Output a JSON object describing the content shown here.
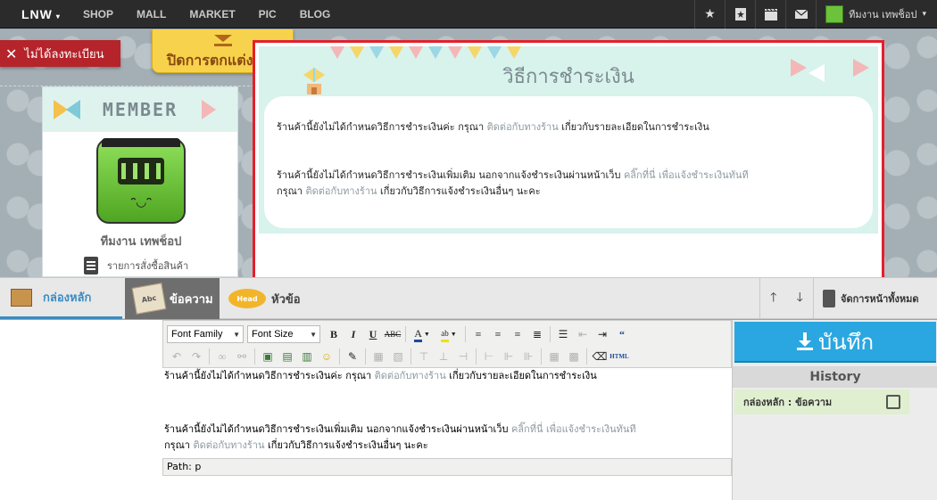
{
  "topnav": {
    "logo": "LNW",
    "links": [
      "SHOP",
      "MALL",
      "MARKET",
      "PIC",
      "BLOG"
    ],
    "icons": [
      "star-icon",
      "bookmark-icon",
      "film-icon",
      "mail-icon"
    ],
    "user_name": "ทีมงาน เทพช็อป"
  },
  "banner": {
    "not_registered": "ไม่ได้ลงทะเบียน",
    "close_decorate": "ปิดการตกแต่งร้าน"
  },
  "sidebar": {
    "title": "MEMBER",
    "user_name": "ทีมงาน เทพช็อป",
    "orders_label": "รายการสั่งซื้อสินค้า"
  },
  "payment": {
    "title": "วิธีการชำระเงิน",
    "p1_text": "ร้านค้านี้ยังไม่ได้กำหนดวิธีการชำระเงินค่ะ กรุณา ",
    "p1_link": "ติดต่อกับทางร้าน",
    "p1_tail": " เกี่ยวกับรายละเอียดในการชำระเงิน",
    "p2_text": "ร้านค้านี้ยังไม่ได้กำหนดวิธีการชำระเงินเพิ่มเติม นอกจากแจ้งชำระเงินผ่านหน้าเว็บ ",
    "p2_link": "คลิ๊กที่นี่ เพื่อแจ้งชำระเงินทันที",
    "p3_text": "กรุณา ",
    "p3_link": "ติดต่อกับทางร้าน",
    "p3_tail": " เกี่ยวกับวิธีการแจ้งชำระเงินอื่นๆ นะคะ"
  },
  "tabs": {
    "main_box": "กล่องหลัก",
    "text": "ข้อความ",
    "heading": "หัวข้อ",
    "manage_all": "จัดการหน้าทั้งหมด"
  },
  "editor": {
    "font_family": "Font Family",
    "font_size": "Font Size",
    "path": "Path: p"
  },
  "right_panel": {
    "save": "บันทึก",
    "history_title": "History",
    "history_item": "กล่องหลัก : ข้อความ"
  }
}
